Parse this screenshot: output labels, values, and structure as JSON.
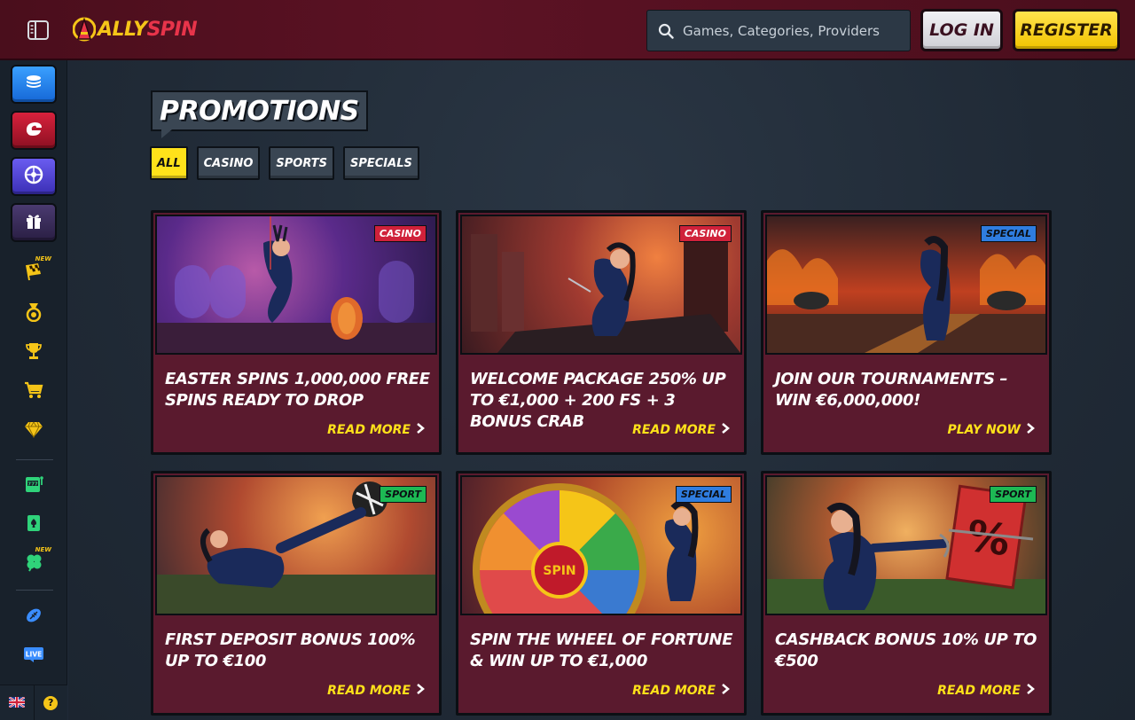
{
  "brand": {
    "logo_text_a": "ALLY",
    "logo_text_b": "SPIN"
  },
  "header": {
    "search_placeholder": "Games, Categories, Providers",
    "login_label": "LOG IN",
    "register_label": "REGISTER"
  },
  "sidebar": {
    "new_badge": "NEW",
    "items": [
      {
        "icon": "lobby-icon"
      },
      {
        "icon": "casino-icon"
      },
      {
        "icon": "live-casino-icon"
      },
      {
        "icon": "gift-icon"
      },
      {
        "icon": "race-flag-icon",
        "new": true
      },
      {
        "icon": "medal-icon"
      },
      {
        "icon": "trophy-icon"
      },
      {
        "icon": "shop-cart-icon"
      },
      {
        "icon": "vip-diamond-icon"
      },
      {
        "icon": "slots-icon"
      },
      {
        "icon": "cards-icon"
      },
      {
        "icon": "clover-icon",
        "new": true
      },
      {
        "icon": "football-icon"
      },
      {
        "icon": "live-icon"
      }
    ],
    "live_label": "LIVE",
    "language": "uk-flag-icon",
    "help_label": "?"
  },
  "main": {
    "title": "PROMOTIONS",
    "filters": [
      "ALL",
      "CASINO",
      "SPORTS",
      "SPECIALS"
    ],
    "active_filter": "ALL",
    "promotions": [
      {
        "tag": "CASINO",
        "title": "EASTER SPINS 1,000,000 FREE SPINS READY TO DROP",
        "cta": "READ MORE"
      },
      {
        "tag": "CASINO",
        "title": "WELCOME PACKAGE 250% UP TO €1,000 + 200 FS + 3 BONUS CRAB",
        "cta": "READ MORE"
      },
      {
        "tag": "SPECIAL",
        "title": "JOIN OUR TOURNAMENTS – WIN €6,000,000!",
        "cta": "PLAY NOW"
      },
      {
        "tag": "SPORT",
        "title": "FIRST DEPOSIT BONUS 100% UP TO €100",
        "cta": "READ MORE"
      },
      {
        "tag": "SPECIAL",
        "title": "SPIN THE WHEEL OF FORTUNE & WIN UP TO €1,000",
        "cta": "READ MORE",
        "image_text": "SPIN"
      },
      {
        "tag": "SPORT",
        "title": "CASHBACK BONUS 10% UP TO €500",
        "cta": "READ MORE"
      }
    ]
  },
  "colors": {
    "accent_yellow": "#ffe21a",
    "card_bg": "#5a1a2e",
    "header_bg": "#5c1224",
    "tag_casino": "#d0213a",
    "tag_sport": "#1db954",
    "tag_special": "#2f7de0"
  }
}
